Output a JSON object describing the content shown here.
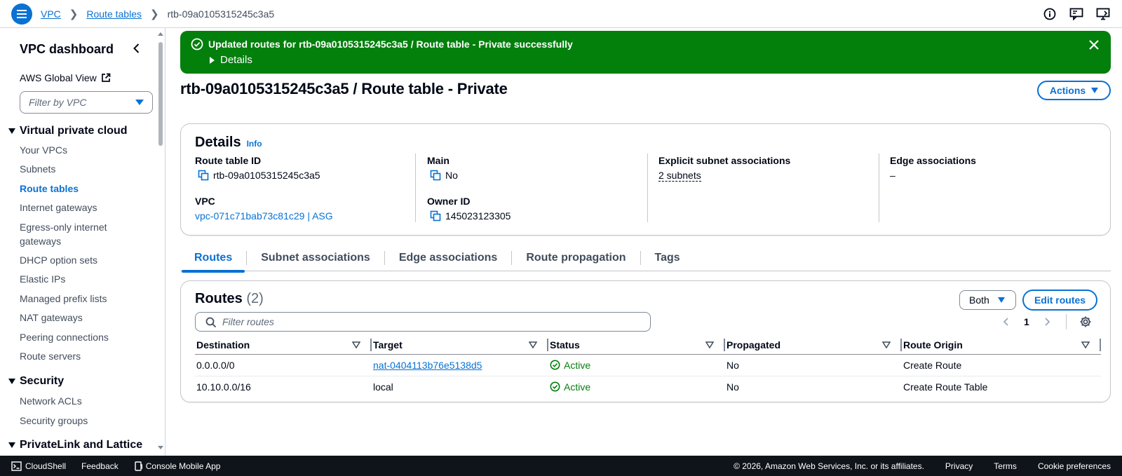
{
  "breadcrumb": {
    "items": [
      "VPC",
      "Route tables"
    ],
    "current": "rtb-09a0105315245c3a5"
  },
  "top_icons": [
    "info-icon",
    "feedback-icon",
    "screen-icon"
  ],
  "sidebar": {
    "title": "VPC dashboard",
    "global_view": "AWS Global View",
    "filter_placeholder": "Filter by VPC",
    "section_vpc": "Virtual private cloud",
    "vpc_items": [
      "Your VPCs",
      "Subnets",
      "Route tables",
      "Internet gateways",
      "Egress-only internet gateways",
      "DHCP option sets",
      "Elastic IPs",
      "Managed prefix lists",
      "NAT gateways",
      "Peering connections",
      "Route servers"
    ],
    "active_item": "Route tables",
    "section_security": "Security",
    "security_items": [
      "Network ACLs",
      "Security groups"
    ],
    "section_privatelink": "PrivateLink and Lattice"
  },
  "flash": {
    "message": "Updated routes for rtb-09a0105315245c3a5 / Route table - Private successfully",
    "details": "Details",
    "color": "#037f0c"
  },
  "page": {
    "title": "rtb-09a0105315245c3a5 / Route table - Private",
    "actions": "Actions"
  },
  "details": {
    "heading": "Details",
    "info": "Info",
    "route_table_id_label": "Route table ID",
    "route_table_id": "rtb-09a0105315245c3a5",
    "main_label": "Main",
    "main": "No",
    "explicit_label": "Explicit subnet associations",
    "explicit": "2 subnets",
    "edge_label": "Edge associations",
    "edge": "–",
    "vpc_label": "VPC",
    "vpc": "vpc-071c71bab73c81c29 | ASG",
    "owner_label": "Owner ID",
    "owner": "145023123305"
  },
  "tabs": [
    "Routes",
    "Subnet associations",
    "Edge associations",
    "Route propagation",
    "Tags"
  ],
  "routes": {
    "heading": "Routes",
    "count": "(2)",
    "select_value": "Both",
    "edit": "Edit routes",
    "filter_placeholder": "Filter routes",
    "page": "1",
    "columns": [
      "Destination",
      "Target",
      "Status",
      "Propagated",
      "Route Origin"
    ],
    "rows": [
      {
        "destination": "0.0.0.0/0",
        "target": "nat-0404113b76e5138d5",
        "status": "Active",
        "propagated": "No",
        "origin": "Create Route"
      },
      {
        "destination": "10.10.0.0/16",
        "target": "local",
        "status": "Active",
        "propagated": "No",
        "origin": "Create Route Table"
      }
    ]
  },
  "footer": {
    "cloudshell": "CloudShell",
    "feedback": "Feedback",
    "mobile": "Console Mobile App",
    "copyright": "© 2026, Amazon Web Services, Inc. or its affiliates.",
    "privacy": "Privacy",
    "terms": "Terms",
    "cookies": "Cookie preferences"
  },
  "colors": {
    "accent": "#0972d3",
    "success": "#037f0c",
    "footer_bg": "#0f141a"
  }
}
